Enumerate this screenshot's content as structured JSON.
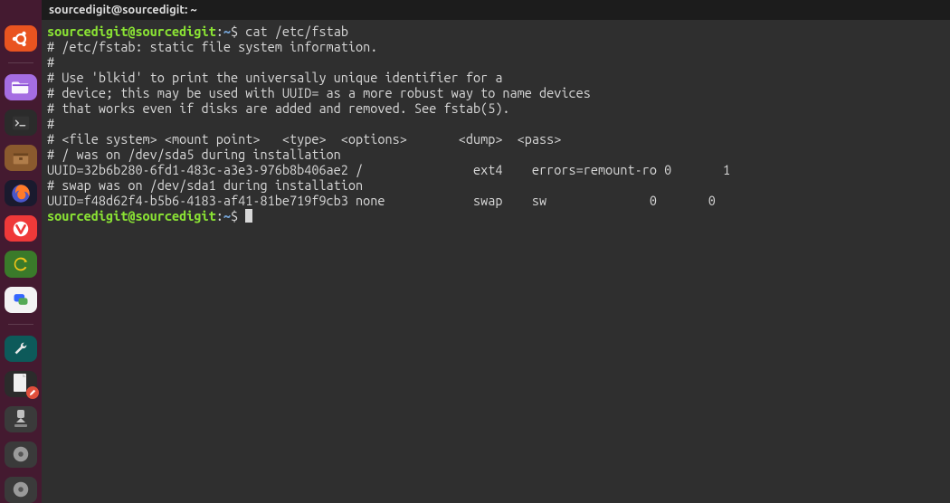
{
  "titlebar": {
    "text": "sourcedigit@sourcedigit: ~"
  },
  "prompt": {
    "user_host": "sourcedigit@sourcedigit",
    "colon": ":",
    "path": "~",
    "symbol": "$"
  },
  "command1": "cat /etc/fstab",
  "output": [
    "# /etc/fstab: static file system information.",
    "#",
    "# Use 'blkid' to print the universally unique identifier for a",
    "# device; this may be used with UUID= as a more robust way to name devices",
    "# that works even if disks are added and removed. See fstab(5).",
    "#",
    "# <file system> <mount point>   <type>  <options>       <dump>  <pass>",
    "# / was on /dev/sda5 during installation",
    "UUID=32b6b280-6fd1-483c-a3e3-976b8b406ae2 /               ext4    errors=remount-ro 0       1",
    "# swap was on /dev/sda1 during installation",
    "UUID=f48d62f4-b5b6-4183-af41-81be719f9cb3 none            swap    sw              0       0"
  ],
  "dock": {
    "items": [
      {
        "name": "ubuntu",
        "title": "Show Applications"
      },
      {
        "name": "files",
        "title": "Files"
      },
      {
        "name": "terminal",
        "title": "Terminal"
      },
      {
        "name": "archive",
        "title": "Archive Manager"
      },
      {
        "name": "firefox",
        "title": "Firefox"
      },
      {
        "name": "vivaldi",
        "title": "Vivaldi"
      },
      {
        "name": "sync",
        "title": "Sync"
      },
      {
        "name": "chat",
        "title": "Messaging"
      },
      {
        "name": "settings",
        "title": "Settings"
      },
      {
        "name": "notes",
        "title": "Notes"
      },
      {
        "name": "download",
        "title": "Downloads"
      },
      {
        "name": "disk1",
        "title": "Disk"
      },
      {
        "name": "disk2",
        "title": "Disk"
      }
    ]
  }
}
